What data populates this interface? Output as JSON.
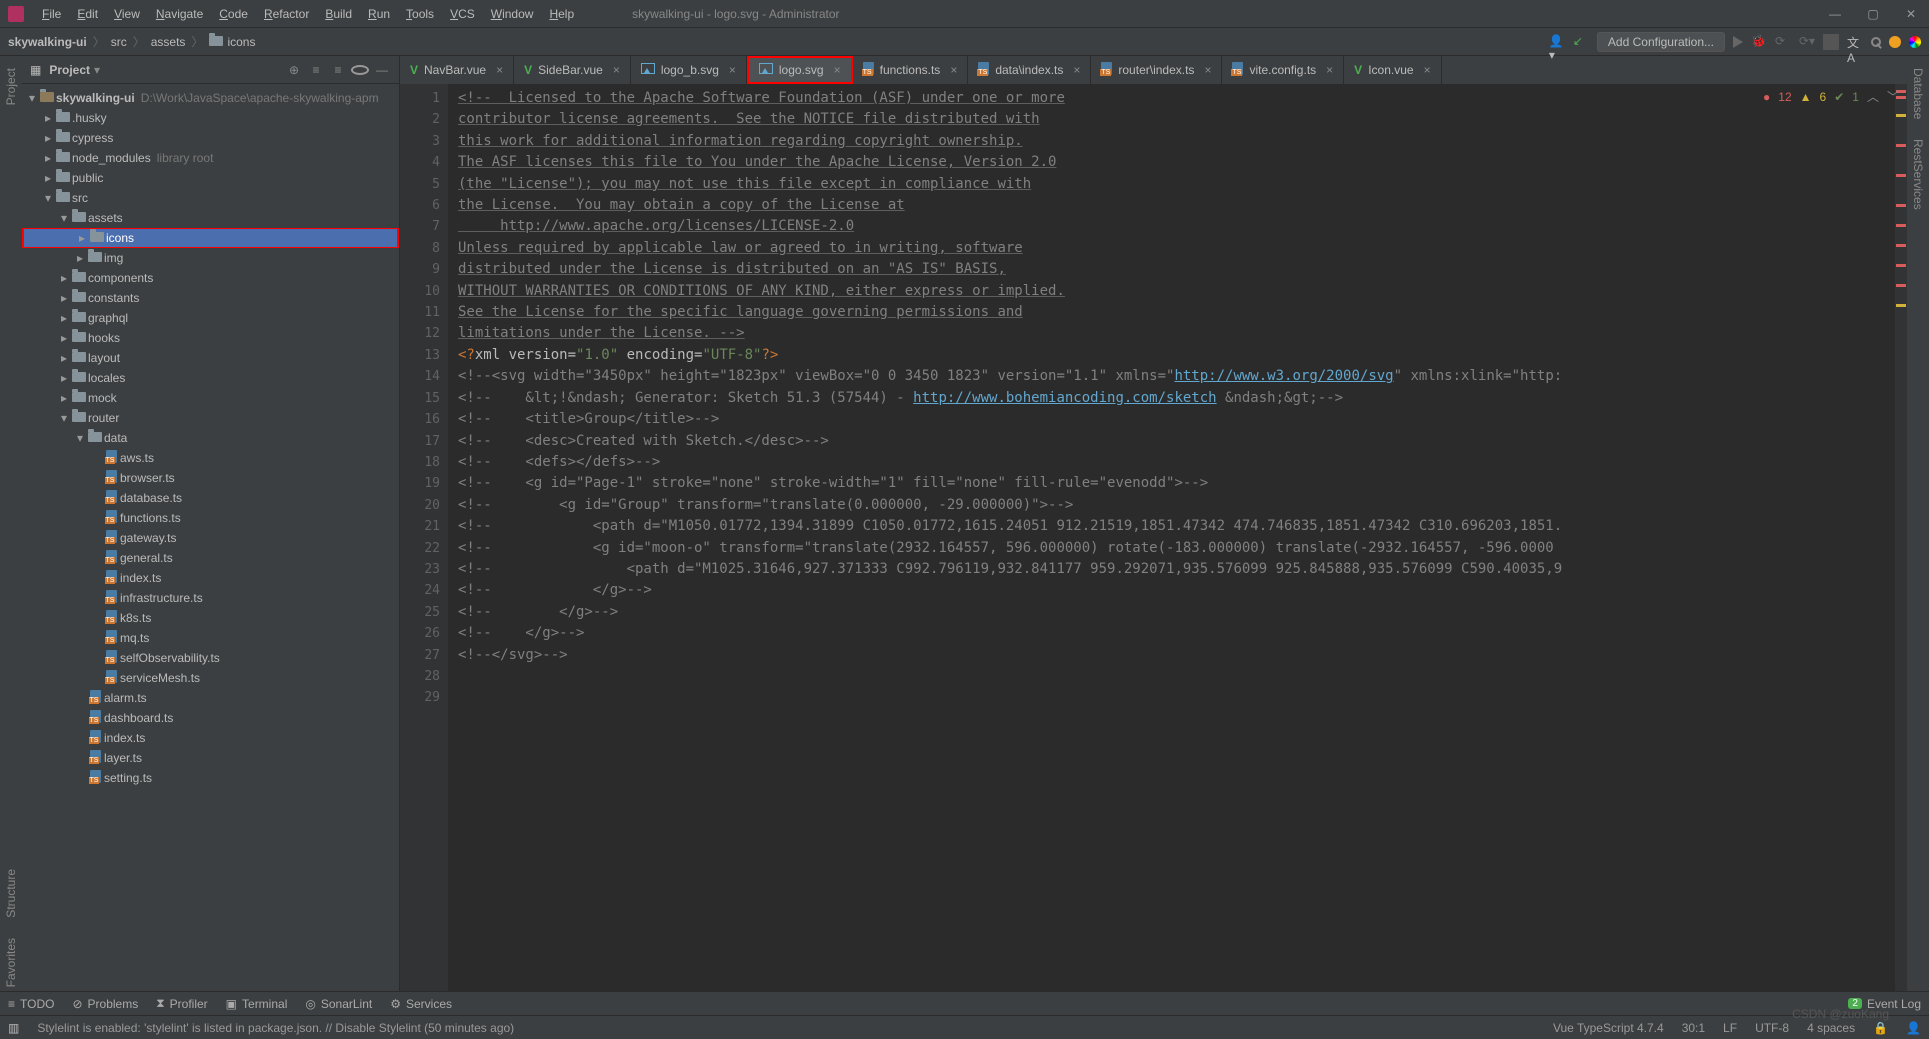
{
  "window": {
    "title": "skywalking-ui - logo.svg - Administrator"
  },
  "menu": [
    "File",
    "Edit",
    "View",
    "Navigate",
    "Code",
    "Refactor",
    "Build",
    "Run",
    "Tools",
    "VCS",
    "Window",
    "Help"
  ],
  "breadcrumb": [
    "skywalking-ui",
    "src",
    "assets",
    "icons"
  ],
  "run_config_button": "Add Configuration...",
  "project": {
    "panel_label": "Project",
    "root": {
      "name": "skywalking-ui",
      "path": "D:\\Work\\JavaSpace\\apache-skywalking-apm"
    },
    "tree": [
      {
        "name": ".husky",
        "type": "folder",
        "indent": 1,
        "expand": "collapsed"
      },
      {
        "name": "cypress",
        "type": "folder",
        "indent": 1,
        "expand": "collapsed"
      },
      {
        "name": "node_modules",
        "type": "folder",
        "indent": 1,
        "expand": "collapsed",
        "extra": "library root"
      },
      {
        "name": "public",
        "type": "folder",
        "indent": 1,
        "expand": "collapsed"
      },
      {
        "name": "src",
        "type": "folder",
        "indent": 1,
        "expand": "expanded"
      },
      {
        "name": "assets",
        "type": "folder",
        "indent": 2,
        "expand": "expanded"
      },
      {
        "name": "icons",
        "type": "folder",
        "indent": 3,
        "expand": "collapsed",
        "selected": true
      },
      {
        "name": "img",
        "type": "folder",
        "indent": 3,
        "expand": "collapsed"
      },
      {
        "name": "components",
        "type": "folder",
        "indent": 2,
        "expand": "collapsed"
      },
      {
        "name": "constants",
        "type": "folder",
        "indent": 2,
        "expand": "collapsed"
      },
      {
        "name": "graphql",
        "type": "folder",
        "indent": 2,
        "expand": "collapsed"
      },
      {
        "name": "hooks",
        "type": "folder",
        "indent": 2,
        "expand": "collapsed"
      },
      {
        "name": "layout",
        "type": "folder",
        "indent": 2,
        "expand": "collapsed"
      },
      {
        "name": "locales",
        "type": "folder",
        "indent": 2,
        "expand": "collapsed"
      },
      {
        "name": "mock",
        "type": "folder",
        "indent": 2,
        "expand": "collapsed"
      },
      {
        "name": "router",
        "type": "folder",
        "indent": 2,
        "expand": "expanded"
      },
      {
        "name": "data",
        "type": "folder",
        "indent": 3,
        "expand": "expanded"
      },
      {
        "name": "aws.ts",
        "type": "ts",
        "indent": 4
      },
      {
        "name": "browser.ts",
        "type": "ts",
        "indent": 4
      },
      {
        "name": "database.ts",
        "type": "ts",
        "indent": 4
      },
      {
        "name": "functions.ts",
        "type": "ts",
        "indent": 4
      },
      {
        "name": "gateway.ts",
        "type": "ts",
        "indent": 4
      },
      {
        "name": "general.ts",
        "type": "ts",
        "indent": 4
      },
      {
        "name": "index.ts",
        "type": "ts",
        "indent": 4
      },
      {
        "name": "infrastructure.ts",
        "type": "ts",
        "indent": 4
      },
      {
        "name": "k8s.ts",
        "type": "ts",
        "indent": 4
      },
      {
        "name": "mq.ts",
        "type": "ts",
        "indent": 4
      },
      {
        "name": "selfObservability.ts",
        "type": "ts",
        "indent": 4
      },
      {
        "name": "serviceMesh.ts",
        "type": "ts",
        "indent": 4
      },
      {
        "name": "alarm.ts",
        "type": "ts",
        "indent": 3
      },
      {
        "name": "dashboard.ts",
        "type": "ts",
        "indent": 3
      },
      {
        "name": "index.ts",
        "type": "ts",
        "indent": 3
      },
      {
        "name": "layer.ts",
        "type": "ts",
        "indent": 3
      },
      {
        "name": "setting.ts",
        "type": "ts",
        "indent": 3
      }
    ]
  },
  "tabs": [
    {
      "label": "NavBar.vue",
      "kind": "vue"
    },
    {
      "label": "SideBar.vue",
      "kind": "vue"
    },
    {
      "label": "logo_b.svg",
      "kind": "svg"
    },
    {
      "label": "logo.svg",
      "kind": "svg",
      "active": true,
      "highlight": true
    },
    {
      "label": "functions.ts",
      "kind": "ts"
    },
    {
      "label": "data\\index.ts",
      "kind": "ts"
    },
    {
      "label": "router\\index.ts",
      "kind": "ts"
    },
    {
      "label": "vite.config.ts",
      "kind": "ts"
    },
    {
      "label": "Icon.vue",
      "kind": "vue"
    }
  ],
  "inspections": {
    "errors": 12,
    "warnings": 6,
    "ok": 1
  },
  "code_lines": [
    "<!--  Licensed to the Apache Software Foundation (ASF) under one or more",
    "contributor license agreements.  See the NOTICE file distributed with",
    "this work for additional information regarding copyright ownership.",
    "The ASF licenses this file to You under the Apache License, Version 2.0",
    "(the \"License\"); you may not use this file except in compliance with",
    "the License.  You may obtain a copy of the License at",
    "",
    "     http://www.apache.org/licenses/LICENSE-2.0",
    "",
    "Unless required by applicable law or agreed to in writing, software",
    "distributed under the License is distributed on an \"AS IS\" BASIS,",
    "WITHOUT WARRANTIES OR CONDITIONS OF ANY KIND, either express or implied.",
    "See the License for the specific language governing permissions and",
    "limitations under the License. -->",
    "<?xml version=\"1.0\" encoding=\"UTF-8\"?>",
    "<!--<svg width=\"3450px\" height=\"1823px\" viewBox=\"0 0 3450 1823\" version=\"1.1\" xmlns=\"http://www.w3.org/2000/svg\" xmlns:xlink=\"http:",
    "<!--    &lt;!&ndash; Generator: Sketch 51.3 (57544) - http://www.bohemiancoding.com/sketch &ndash;&gt;-->",
    "<!--    <title>Group</title>-->",
    "<!--    <desc>Created with Sketch.</desc>-->",
    "<!--    <defs></defs>-->",
    "<!--    <g id=\"Page-1\" stroke=\"none\" stroke-width=\"1\" fill=\"none\" fill-rule=\"evenodd\">-->",
    "<!--        <g id=\"Group\" transform=\"translate(0.000000, -29.000000)\">-->",
    "<!--            <path d=\"M1050.01772,1394.31899 C1050.01772,1615.24051 912.21519,1851.47342 474.746835,1851.47342 C310.696203,1851.",
    "<!--            <g id=\"moon-o\" transform=\"translate(2932.164557, 596.000000) rotate(-183.000000) translate(-2932.164557, -596.0000",
    "<!--                <path d=\"M1025.31646,927.371333 C992.796119,932.841177 959.292071,935.576099 925.845888,935.576099 C590.40035,9",
    "<!--            </g>-->",
    "<!--        </g>-->",
    "<!--    </g>-->",
    "<!--</svg>-->"
  ],
  "bottom_tools": [
    "TODO",
    "Problems",
    "Profiler",
    "Terminal",
    "SonarLint",
    "Services"
  ],
  "event_log": {
    "badge": "2",
    "label": "Event Log"
  },
  "status": {
    "message": "Stylelint is enabled: 'stylelint' is listed in package.json. // Disable Stylelint (50 minutes ago)",
    "lang": "Vue TypeScript 4.7.4",
    "pos": "30:1",
    "lineend": "LF",
    "encoding": "UTF-8",
    "indent": "4 spaces"
  },
  "side_panels": {
    "left": [
      "Project",
      "Structure",
      "Favorites"
    ],
    "right": [
      "Database",
      "RestServices"
    ]
  },
  "watermark": "CSDN @zuoKang"
}
